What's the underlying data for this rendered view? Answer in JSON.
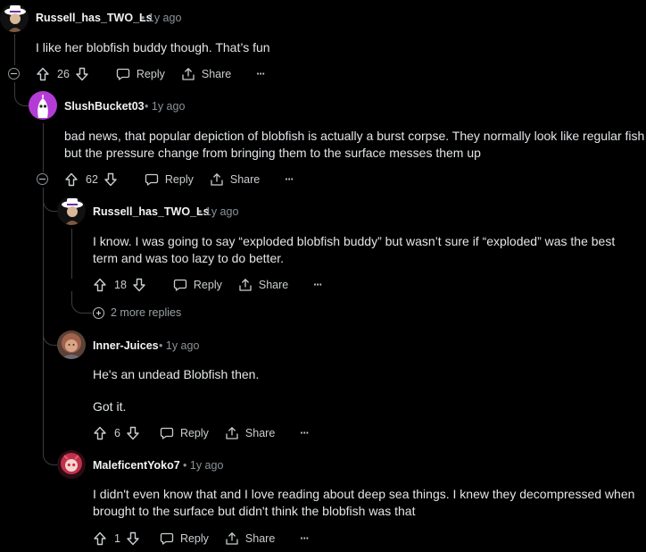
{
  "comments": [
    {
      "author": "Russell_has_TWO_Ls",
      "age": "1y ago",
      "lines": [
        "I like her blobfish buddy though. That’s fun"
      ],
      "votes": "26",
      "reply_label": "Reply",
      "share_label": "Share"
    },
    {
      "author": "SlushBucket03",
      "age": "1y ago",
      "lines": [
        "bad news, that popular depiction of blobfish is actually a burst corpse. They normally look like regular fish",
        "but the pressure change from bringing them to the surface messes them up"
      ],
      "votes": "62",
      "reply_label": "Reply",
      "share_label": "Share"
    },
    {
      "author": "Russell_has_TWO_Ls",
      "age": "1y ago",
      "lines": [
        "I know. I was going to say “exploded blobfish buddy” but wasn’t sure if “exploded” was the best",
        "term and was too lazy to do better."
      ],
      "votes": "18",
      "reply_label": "Reply",
      "share_label": "Share",
      "more_replies": "2 more replies"
    },
    {
      "author": "Inner-Juices",
      "age": "1y ago",
      "lines": [
        "He's an undead Blobfish then.",
        "Got it."
      ],
      "votes": "6",
      "reply_label": "Reply",
      "share_label": "Share"
    },
    {
      "author": "MaleficentYoko7",
      "age": "1y ago",
      "lines": [
        "I didn't even know that and I love reading about deep sea things. I knew they decompressed when",
        "brought to the surface but didn't think the blobfish was that"
      ],
      "votes": "1",
      "reply_label": "Reply",
      "share_label": "Share"
    }
  ],
  "meta_separator": "•",
  "more_options_label": "···",
  "colors": {
    "background": "#000000",
    "text": "#e2e5e8",
    "muted": "#8b9297",
    "thread_line": "#3a3e42"
  },
  "icons": [
    "upvote-icon",
    "downvote-icon",
    "reply-bubble-icon",
    "share-icon",
    "more-options-icon",
    "collapse-icon",
    "expand-plus-icon"
  ]
}
